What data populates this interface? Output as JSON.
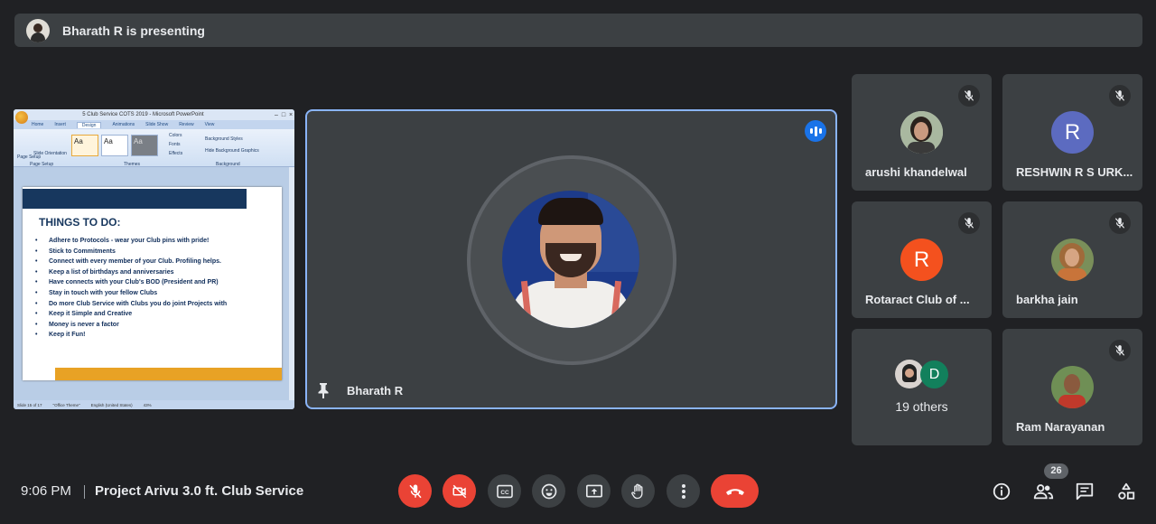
{
  "banner": {
    "presenting_text": "Bharath R is presenting",
    "avatar_icon": "presenter-avatar"
  },
  "presentation": {
    "window_title": "5 Club Service COTS 2019 - Microsoft PowerPoint",
    "ribbon_tabs": [
      "Home",
      "Insert",
      "Design",
      "Animations",
      "Slide Show",
      "Review",
      "View"
    ],
    "active_tab": "Design",
    "ribbon": {
      "page_setup": "Page Setup",
      "slide_orientation": "Slide Orientation",
      "group_page_setup": "Page Setup",
      "group_themes": "Themes",
      "group_background": "Background",
      "colors": "Colors",
      "fonts": "Fonts",
      "effects": "Effects",
      "background_styles": "Background Styles",
      "hide_background": "Hide Background Graphics",
      "theme_sample": "Aa"
    },
    "slide": {
      "heading": "THINGS TO DO:",
      "bullets": [
        "Adhere to Protocols - wear your Club pins with pride!",
        "Stick to Commitments",
        "Connect with every member of your Club. Profiling helps.",
        "Keep a list of birthdays and anniversaries",
        "Have connects with your Club's BOD (President and PR)",
        "Stay in touch with your fellow Clubs",
        "Do more Club Service with Clubs you do joint Projects with",
        "Keep it Simple and Creative",
        "Money is never a factor",
        "Keep it Fun!"
      ]
    },
    "status": {
      "slide": "Slide 15 of 17",
      "theme": "\"Office Theme\"",
      "language": "English (United States)",
      "zoom": "43%"
    }
  },
  "main_tile": {
    "name": "Bharath R",
    "speaking_icon": "speaking-indicator-icon",
    "pin_icon": "pin-icon"
  },
  "participants": [
    {
      "name": "arushi khandelwal",
      "initial": "",
      "avatar_color": "#6b6b6b",
      "muted": true
    },
    {
      "name": "RESHWIN R S URK...",
      "initial": "R",
      "avatar_color": "#5c6bc0",
      "muted": true
    },
    {
      "name": "Rotaract Club of ...",
      "initial": "R",
      "avatar_color": "#f4511e",
      "muted": true
    },
    {
      "name": "barkha jain",
      "initial": "",
      "avatar_color": "#8a6a4a",
      "muted": true
    },
    {
      "name": "Ram Narayanan",
      "initial": "",
      "avatar_color": "#5c7a4a",
      "muted": true
    }
  ],
  "others": {
    "label": "19 others",
    "initial": "D",
    "initial_color": "#12805c"
  },
  "bottom_bar": {
    "time": "9:06 PM",
    "meeting_title": "Project Arivu 3.0 ft. Club Service",
    "participant_count": "26",
    "controls": [
      "mic-off",
      "camera-off",
      "captions",
      "emoji",
      "present",
      "raise-hand",
      "more-options",
      "leave-call"
    ],
    "right_icons": [
      "meeting-info",
      "people",
      "chat",
      "activities"
    ]
  }
}
